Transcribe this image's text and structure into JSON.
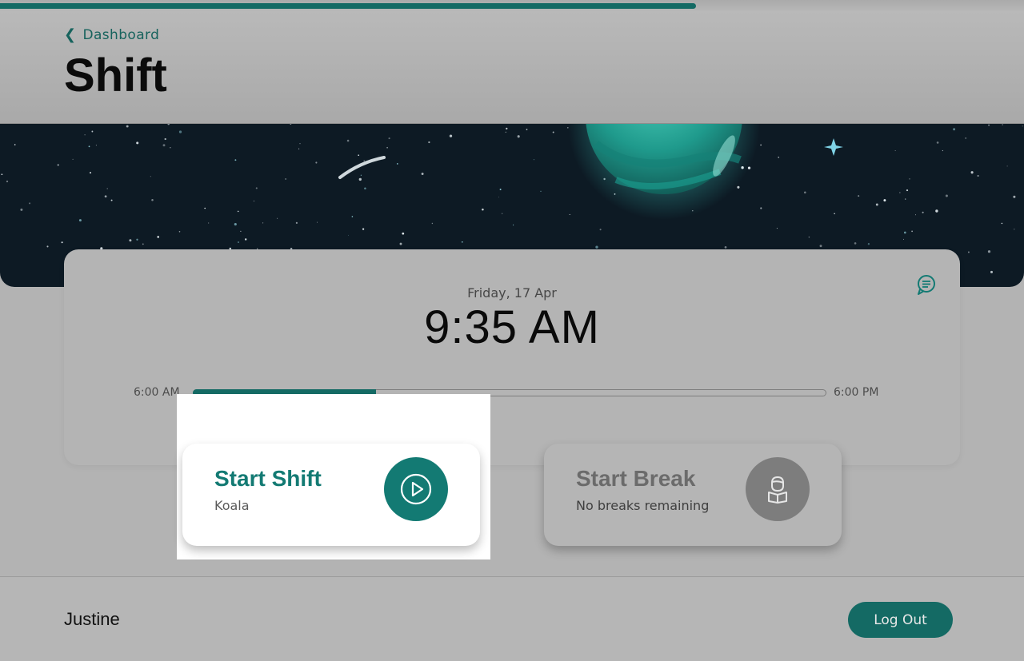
{
  "top_progress": {
    "fraction": 0.68
  },
  "header": {
    "back_label": "Dashboard",
    "title": "Shift"
  },
  "clock": {
    "date": "Friday, 17 Apr",
    "time": "9:35 AM",
    "shift_start": "6:00 AM",
    "shift_end": "6:00 PM",
    "shift_progress": 0.29
  },
  "actions": {
    "start_shift": {
      "title": "Start Shift",
      "subtitle": "Koala"
    },
    "start_break": {
      "title": "Start Break",
      "subtitle": "No breaks remaining"
    }
  },
  "footer": {
    "user_name": "Justine",
    "logout_label": "Log Out"
  },
  "icons": {
    "back": "chevron-left-icon",
    "chat": "chat-bubble-icon",
    "start": "play-circle-icon",
    "break": "reading-person-icon"
  },
  "colors": {
    "accent": "#146a64",
    "accent_text": "#137a73",
    "banner_bg": "#0d1a24",
    "planet": "#2fb3a5"
  }
}
